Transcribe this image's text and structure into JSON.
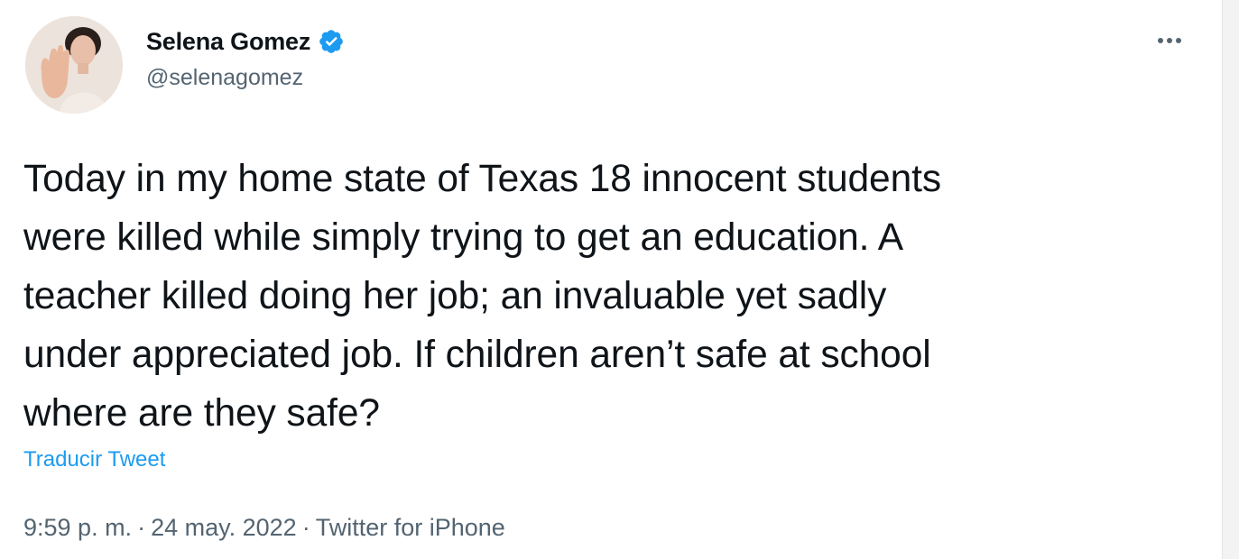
{
  "author": {
    "display_name": "Selena Gomez",
    "handle": "@selenagomez",
    "verified": true,
    "avatar_icon": "profile-photo",
    "verified_icon": "verified-badge-icon",
    "verified_color": "#1d9bf0"
  },
  "menu": {
    "more_icon": "more-options-icon"
  },
  "tweet": {
    "text": "Today in my home state of Texas 18 innocent students\nwere killed while simply trying to get an education. A\nteacher killed doing her job; an invaluable yet sadly\nunder appreciated job. If children aren’t safe at school\nwhere are they safe?",
    "translate_label": "Traducir Tweet",
    "time": "9:59 p. m.",
    "separator": "·",
    "date": "24 may. 2022",
    "source": "Twitter for iPhone"
  },
  "colors": {
    "text": "#0f1419",
    "secondary": "#536471",
    "link": "#1d9bf0"
  }
}
